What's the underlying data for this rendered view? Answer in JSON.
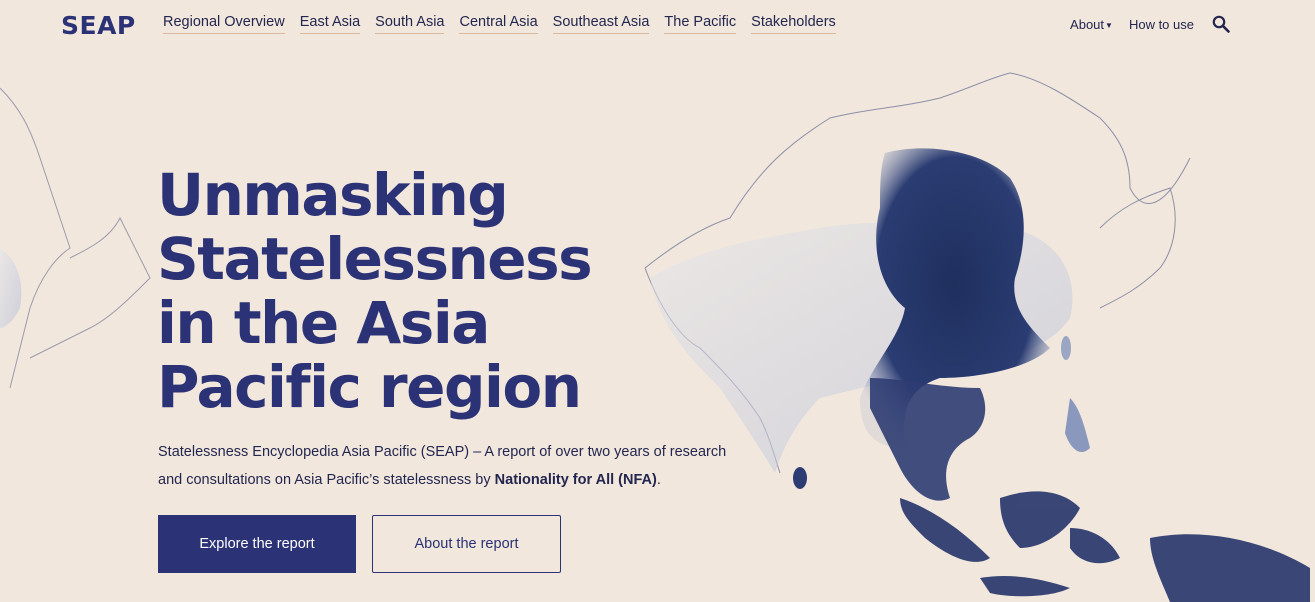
{
  "header": {
    "logo": "SEAP",
    "nav": [
      {
        "label": "Regional Overview"
      },
      {
        "label": "East Asia"
      },
      {
        "label": "South Asia"
      },
      {
        "label": "Central Asia"
      },
      {
        "label": "Southeast Asia"
      },
      {
        "label": "The Pacific"
      },
      {
        "label": "Stakeholders"
      }
    ],
    "about_label": "About",
    "how_to_use_label": "How to use"
  },
  "hero": {
    "title": "Unmasking Statelessness in the Asia Pacific region",
    "description_prefix": "Statelessness Encyclopedia Asia Pacific (SEAP) – A report of over two years of research and consultations on Asia Pacific’s statelessness by ",
    "description_org": "Nationality for All (NFA)",
    "description_suffix": ".",
    "primary_button": "Explore the report",
    "secondary_button": "About the report"
  },
  "colors": {
    "background": "#f1e7dd",
    "brand": "#2b3275",
    "text": "#23264f"
  }
}
